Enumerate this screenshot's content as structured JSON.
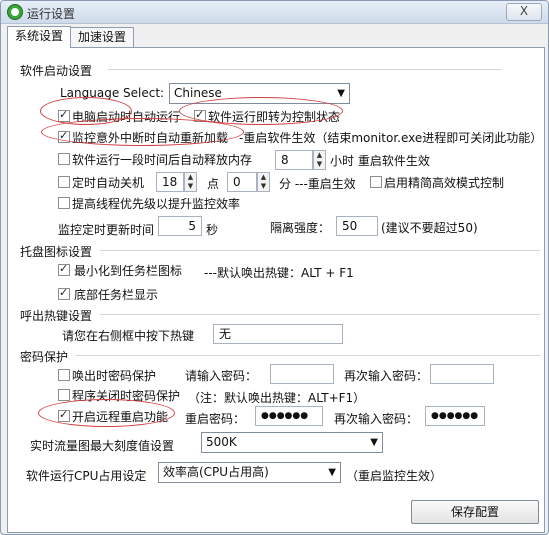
{
  "window": {
    "title": "运行设置",
    "close_label": "X"
  },
  "tabs": [
    {
      "label": "系统设置"
    },
    {
      "label": "加速设置"
    }
  ],
  "startup": {
    "section_title": "软件启动设置",
    "language_label": "Language Select:",
    "language_value": "Chinese",
    "auto_start_label": "电脑启动时自动运行",
    "to_control_label": "软件运行即转为控制状态",
    "reload_label": "监控意外中断时自动重新加载",
    "reload_note": "-重启软件生效（结束monitor.exe进程即可关闭此功能）",
    "release_mem_label": "软件运行一段时间后自动释放内存",
    "release_mem_value": "8",
    "release_mem_unit": "小时 重启软件生效",
    "shutdown_label": "定时自动关机",
    "shutdown_hour": "18",
    "shutdown_hour_unit": "点",
    "shutdown_min": "0",
    "shutdown_min_unit": "分 ---重启生效",
    "precise_label": "启用精简高效模式控制",
    "priority_label": "提高线程优先级以提升监控效率",
    "refresh_label": "监控定时更新时间",
    "refresh_value": "5",
    "refresh_unit": "秒",
    "isolation_label": "隔离强度：",
    "isolation_value": "50",
    "isolation_note": "(建议不要超过50)"
  },
  "tray": {
    "section_title": "托盘图标设置",
    "minimize_label": "最小化到任务栏图标",
    "hotkey_note": "---默认唤出热键：ALT + F1",
    "bottom_label": "底部任务栏显示"
  },
  "hotkey": {
    "section_title": "呼出热键设置",
    "prompt": "请您在右侧框中按下热键",
    "value": "无"
  },
  "password": {
    "section_title": "密码保护",
    "wake_label": "唤出时密码保护",
    "enter_label": "请输入密码：",
    "again_label": "再次输入密码：",
    "close_label": "程序关闭时密码保护",
    "close_note": "（注：默认唤出热键：ALT+F1）",
    "remote_label": "开启远程重启功能",
    "restart_pwd_label": "重启密码：",
    "restart_pwd_value": "●●●●●●",
    "restart_again_label": "再次输入密码：",
    "restart_again_value": "●●●●●●"
  },
  "traffic": {
    "label": "实时流量图最大刻度值设置",
    "value": "500K"
  },
  "cpu": {
    "label": "软件运行CPU占用设定",
    "value": "效率高(CPU占用高)",
    "note": "（重启监控生效）"
  },
  "save_label": "保存配置",
  "colors": {
    "annotation": "#d24040",
    "panel_border": "#8d9cb0"
  }
}
